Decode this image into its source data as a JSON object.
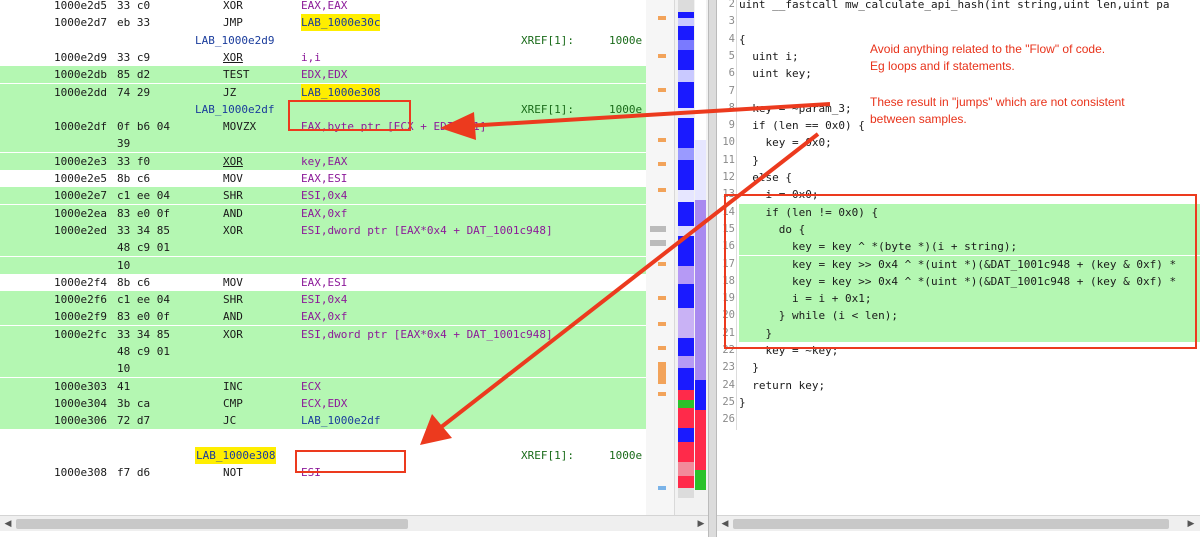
{
  "listing": {
    "rows": [
      {
        "addr": "1000e2d5",
        "bytes": "33 c0",
        "mnemonic": "XOR",
        "operand": "EAX,EAX",
        "hl": false
      },
      {
        "addr": "1000e2d7",
        "bytes": "eb 33",
        "mnemonic": "JMP",
        "operand": "LAB_1000e30c",
        "hl": false
      },
      {
        "label": "LAB_1000e2d9",
        "xref": "XREF[1]:",
        "xref_addr": "1000e",
        "hl": false
      },
      {
        "addr": "1000e2d9",
        "bytes": "33 c9",
        "mnemonic": "XOR",
        "operand": "i,i",
        "hl": false
      },
      {
        "addr": "1000e2db",
        "bytes": "85 d2",
        "mnemonic": "TEST",
        "operand": "EDX,EDX",
        "hl": true
      },
      {
        "addr": "1000e2dd",
        "bytes": "74 29",
        "mnemonic": "JZ",
        "operand": "LAB_1000e308",
        "hl": true
      },
      {
        "label": "LAB_1000e2df",
        "xref": "XREF[1]:",
        "xref_addr": "1000e",
        "hl": true
      },
      {
        "addr": "1000e2df",
        "bytes": "0f b6 04",
        "mnemonic": "MOVZX",
        "operand": "EAX,byte ptr [ECX + EDI*0x1]",
        "hl": true
      },
      {
        "bytes": "39",
        "hl": true
      },
      {
        "addr": "1000e2e3",
        "bytes": "33 f0",
        "mnemonic": "XOR",
        "operand": "key,EAX",
        "hl": true
      },
      {
        "addr": "1000e2e5",
        "bytes": "8b c6",
        "mnemonic": "MOV",
        "operand": "EAX,ESI",
        "hl": false
      },
      {
        "addr": "1000e2e7",
        "bytes": "c1 ee 04",
        "mnemonic": "SHR",
        "operand": "ESI,0x4",
        "hl": true
      },
      {
        "addr": "1000e2ea",
        "bytes": "83 e0 0f",
        "mnemonic": "AND",
        "operand": "EAX,0xf",
        "hl": true
      },
      {
        "addr": "1000e2ed",
        "bytes": "33 34 85",
        "mnemonic": "XOR",
        "operand": "ESI,dword ptr [EAX*0x4 + DAT_1001c948]",
        "hl": true
      },
      {
        "bytes": "48 c9 01",
        "hl": true
      },
      {
        "bytes": "10",
        "hl": true
      },
      {
        "addr": "1000e2f4",
        "bytes": "8b c6",
        "mnemonic": "MOV",
        "operand": "EAX,ESI",
        "hl": false
      },
      {
        "addr": "1000e2f6",
        "bytes": "c1 ee 04",
        "mnemonic": "SHR",
        "operand": "ESI,0x4",
        "hl": true
      },
      {
        "addr": "1000e2f9",
        "bytes": "83 e0 0f",
        "mnemonic": "AND",
        "operand": "EAX,0xf",
        "hl": true
      },
      {
        "addr": "1000e2fc",
        "bytes": "33 34 85",
        "mnemonic": "XOR",
        "operand": "ESI,dword ptr [EAX*0x4 + DAT_1001c948]",
        "hl": true
      },
      {
        "bytes": "48 c9 01",
        "hl": true
      },
      {
        "bytes": "10",
        "hl": true
      },
      {
        "addr": "1000e303",
        "bytes": "41",
        "mnemonic": "INC",
        "operand": "ECX",
        "hl": true
      },
      {
        "addr": "1000e304",
        "bytes": "3b ca",
        "mnemonic": "CMP",
        "operand": "ECX,EDX",
        "hl": true
      },
      {
        "addr": "1000e306",
        "bytes": "72 d7",
        "mnemonic": "JC",
        "operand": "LAB_1000e2df",
        "hl": true
      },
      {
        "spacer": true,
        "hl": false
      },
      {
        "label": "LAB_1000e308",
        "xref": "XREF[1]:",
        "xref_addr": "1000e",
        "hl": false
      },
      {
        "addr": "1000e308",
        "bytes": "f7 d6",
        "mnemonic": "NOT",
        "operand": "ESI",
        "hl": false
      }
    ]
  },
  "decompiler": {
    "lines": [
      {
        "n": "2",
        "text": "uint __fastcall mw_calculate_api_hash(int string,uint len,uint pa",
        "hl": false
      },
      {
        "n": "3",
        "text": "",
        "hl": false
      },
      {
        "n": "4",
        "text": "{",
        "hl": false
      },
      {
        "n": "5",
        "text": "  uint i;",
        "hl": false
      },
      {
        "n": "6",
        "text": "  uint key;",
        "hl": false
      },
      {
        "n": "7",
        "text": "",
        "hl": false
      },
      {
        "n": "8",
        "text": "  key = ~param_3;",
        "hl": false
      },
      {
        "n": "9",
        "text": "  if (len == 0x0) {",
        "hl": false
      },
      {
        "n": "10",
        "text": "    key = 0x0;",
        "hl": false
      },
      {
        "n": "11",
        "text": "  }",
        "hl": false
      },
      {
        "n": "12",
        "text": "  else {",
        "hl": false
      },
      {
        "n": "13",
        "text": "    i = 0x0;",
        "hl": false
      },
      {
        "n": "14",
        "text": "    if (len != 0x0) {",
        "hl": true
      },
      {
        "n": "15",
        "text": "      do {",
        "hl": true
      },
      {
        "n": "16",
        "text": "        key = key ^ *(byte *)(i + string);",
        "hl": true
      },
      {
        "n": "17",
        "text": "        key = key >> 0x4 ^ *(uint *)(&DAT_1001c948 + (key & 0xf) *",
        "hl": true
      },
      {
        "n": "18",
        "text": "        key = key >> 0x4 ^ *(uint *)(&DAT_1001c948 + (key & 0xf) *",
        "hl": true
      },
      {
        "n": "19",
        "text": "        i = i + 0x1;",
        "hl": true
      },
      {
        "n": "20",
        "text": "      } while (i < len);",
        "hl": true
      },
      {
        "n": "21",
        "text": "    }",
        "hl": true
      },
      {
        "n": "22",
        "text": "    key = ~key;",
        "hl": false
      },
      {
        "n": "23",
        "text": "  }",
        "hl": false
      },
      {
        "n": "24",
        "text": "  return key;",
        "hl": false
      },
      {
        "n": "25",
        "text": "}",
        "hl": false
      },
      {
        "n": "26",
        "text": "",
        "hl": false
      }
    ]
  },
  "annotations": {
    "note1_line1": "Avoid anything related to the \"Flow\" of code.",
    "note1_line2": "Eg loops and if statements.",
    "note2_line1": "These result in \"jumps\" which are not consistent",
    "note2_line2": "between samples."
  },
  "colors": {
    "highlight": "#b4f7b2",
    "annotation": "#ec3a1e",
    "label_highlight": "#ffee00"
  }
}
